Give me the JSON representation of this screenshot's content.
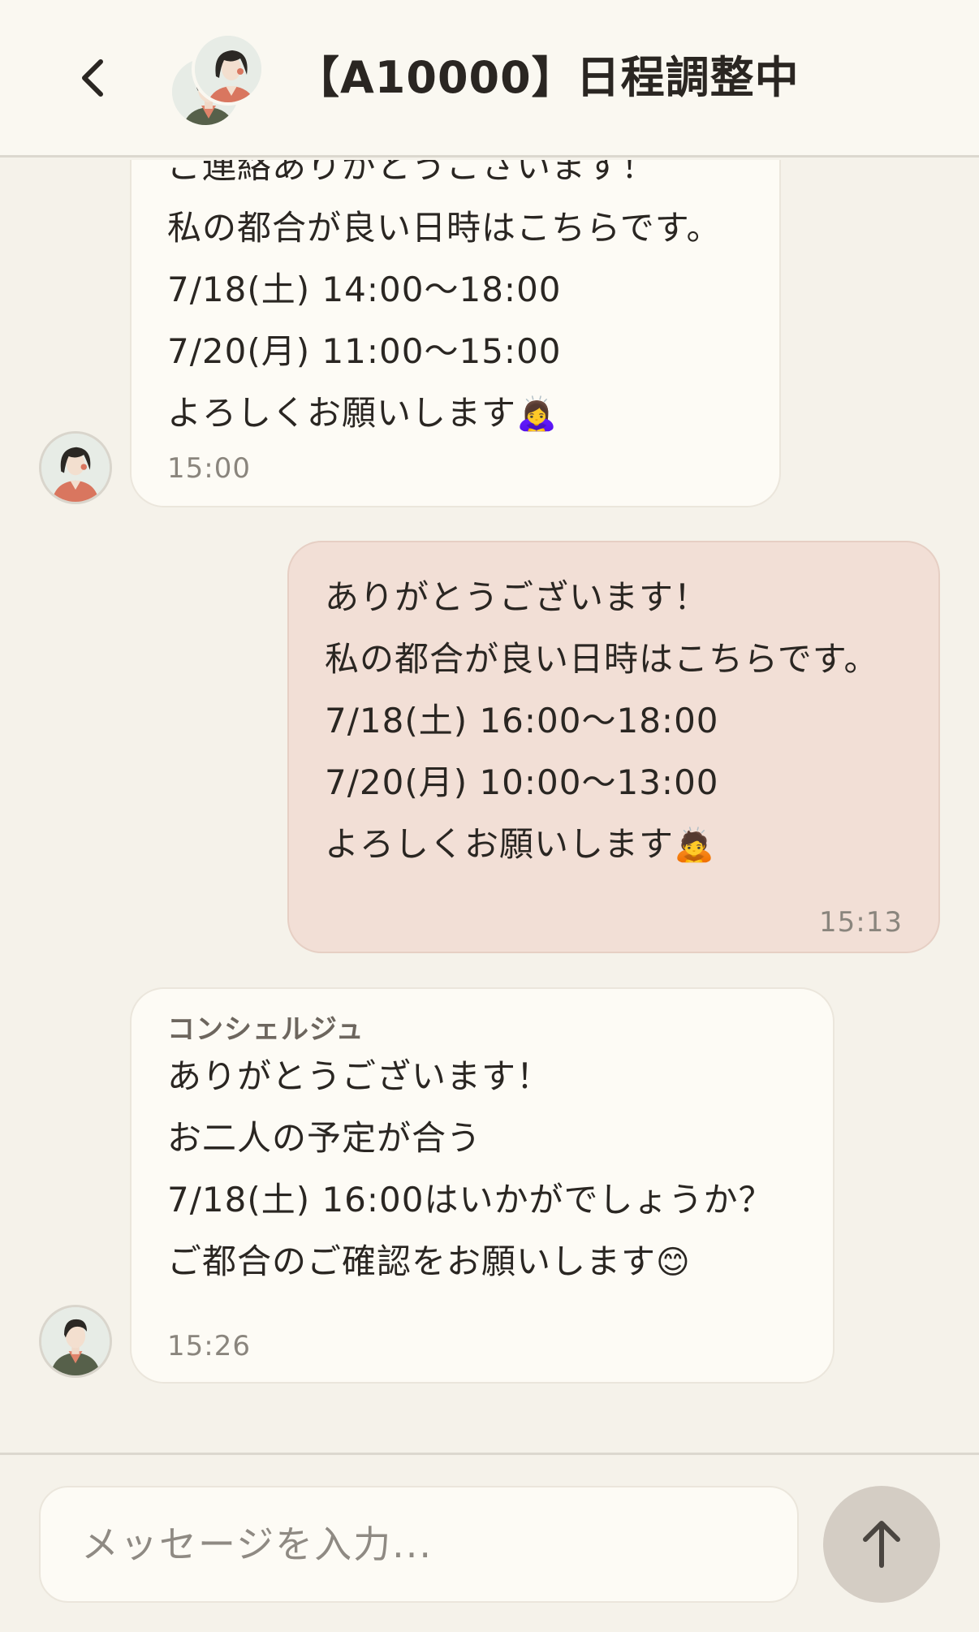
{
  "header": {
    "title": "【A10000】日程調整中",
    "back_icon": "chevron-left-icon"
  },
  "messages": [
    {
      "direction": "incoming",
      "partial_top": "ご連絡ありがとうございます！",
      "lines": [
        "私の都合が良い日時はこちらです。",
        "7/18(土) 14:00〜18:00",
        "7/20(月) 11:00〜15:00",
        "よろしくお願いします"
      ],
      "emoji": "🙇‍♀️",
      "time": "15:00"
    },
    {
      "direction": "outgoing",
      "lines": [
        "ありがとうございます！",
        "私の都合が良い日時はこちらです。",
        "7/18(土) 16:00〜18:00",
        "7/20(月) 10:00〜13:00",
        "よろしくお願いします"
      ],
      "emoji": "🙇",
      "time": "15:13"
    },
    {
      "direction": "incoming",
      "sender": "コンシェルジュ",
      "lines": [
        "ありがとうございます！",
        "お二人の予定が合う",
        "7/18(土) 16:00はいかがでしょうか？",
        "ご都合のご確認をお願いします"
      ],
      "emoji": "😊",
      "time": "15:26"
    }
  ],
  "composer": {
    "placeholder": "メッセージを入力...",
    "send_icon": "arrow-up-icon"
  },
  "colors": {
    "background": "#f5f2ea",
    "incoming_bubble": "#fdfbf5",
    "outgoing_bubble": "#f2dfd6",
    "send_button": "#d4cdc4"
  }
}
